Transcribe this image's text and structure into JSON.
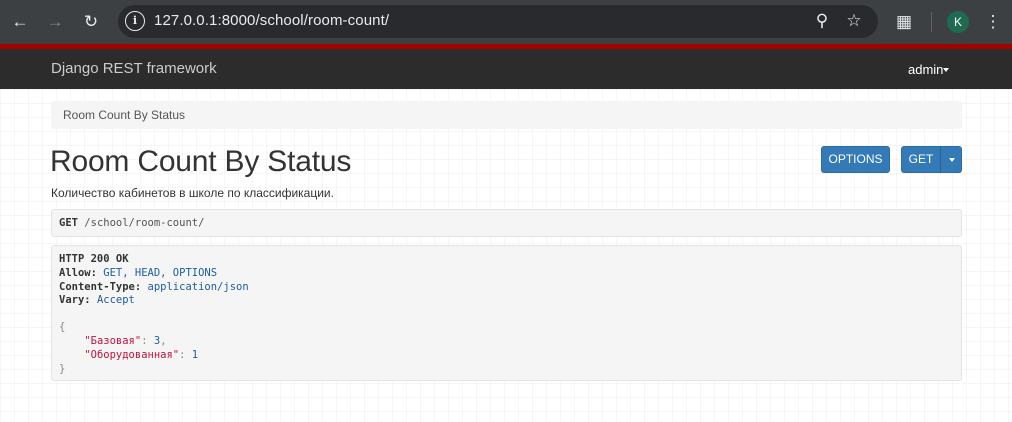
{
  "browser": {
    "url": "127.0.0.1:8000/school/room-count/",
    "profile_initial": "K",
    "icons": [
      "back-arrow-icon",
      "forward-arrow-icon",
      "reload-icon",
      "site-info-icon",
      "zoom-icon",
      "bookmark-star-icon",
      "extensions-icon",
      "menu-dots-icon"
    ]
  },
  "navbar": {
    "brand": "Django REST framework",
    "user": "admin"
  },
  "breadcrumb": {
    "item": "Room Count By Status"
  },
  "page": {
    "title": "Room Count By Status",
    "description": "Количество кабинетов в школе по классификации."
  },
  "buttons": {
    "options": "OPTIONS",
    "get": "GET"
  },
  "request": {
    "method": "GET",
    "path": "/school/room-count/"
  },
  "response": {
    "status": "HTTP 200 OK",
    "allow_label": "Allow:",
    "allow_value": "GET, HEAD, OPTIONS",
    "content_type_label": "Content-Type:",
    "content_type_value": "application/json",
    "vary_label": "Vary:",
    "vary_value": "Accept",
    "open_brace": "{",
    "close_brace": "}",
    "entries": [
      {
        "key": "\"Базовая\"",
        "value": "3",
        "trail": ","
      },
      {
        "key": "\"Оборудованная\"",
        "value": "1",
        "trail": ""
      }
    ]
  },
  "colors": {
    "accent": "#337ab7",
    "navbar": "#2c2c2c",
    "strip": "#a30000",
    "json_key": "#c0143c"
  }
}
